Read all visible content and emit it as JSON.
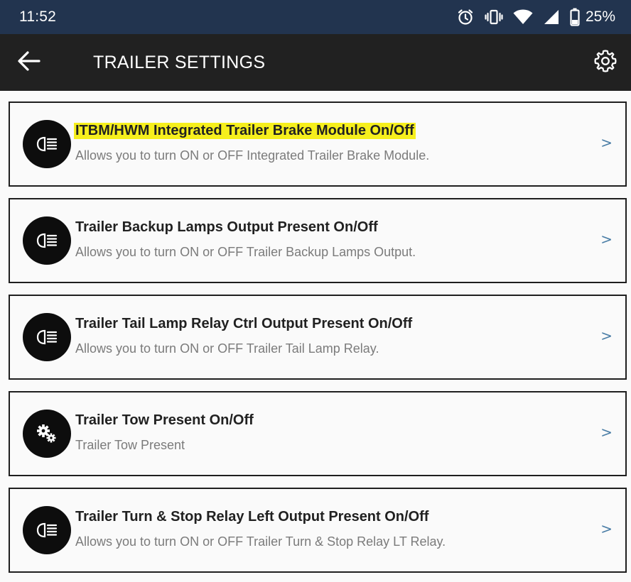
{
  "status_bar": {
    "time": "11:52",
    "battery": "25%",
    "icons": [
      "alarm-icon",
      "vibrate-icon",
      "wifi-icon",
      "signal-icon",
      "battery-icon"
    ]
  },
  "app_bar": {
    "title": "TRAILER SETTINGS",
    "back_icon": "arrow-left-icon",
    "settings_icon": "gear-icon"
  },
  "items": [
    {
      "title": "ITBM/HWM Integrated Trailer Brake Module On/Off",
      "subtitle": "Allows you to turn ON or OFF Integrated Trailer Brake Module.",
      "icon": "headlamp-icon",
      "highlighted": true,
      "chevron": ">"
    },
    {
      "title": "Trailer Backup Lamps Output Present On/Off",
      "subtitle": "Allows you to turn ON or OFF Trailer Backup Lamps Output.",
      "icon": "headlamp-icon",
      "highlighted": false,
      "chevron": ">"
    },
    {
      "title": "Trailer Tail Lamp Relay Ctrl Output Present On/Off",
      "subtitle": "Allows you to turn ON or OFF Trailer Tail Lamp Relay.",
      "icon": "headlamp-icon",
      "highlighted": false,
      "chevron": ">"
    },
    {
      "title": "Trailer Tow Present On/Off",
      "subtitle": "Trailer Tow Present",
      "icon": "gears-icon",
      "highlighted": false,
      "chevron": ">"
    },
    {
      "title": "Trailer Turn & Stop Relay Left Output Present On/Off",
      "subtitle": "Allows you to turn ON or OFF Trailer Turn & Stop Relay LT Relay.",
      "icon": "headlamp-icon",
      "highlighted": false,
      "chevron": ">"
    }
  ],
  "colors": {
    "status_bar_bg": "#22344f",
    "app_bar_bg": "#212121",
    "highlight": "#f6ef1d",
    "chevron": "#4a7da6"
  }
}
